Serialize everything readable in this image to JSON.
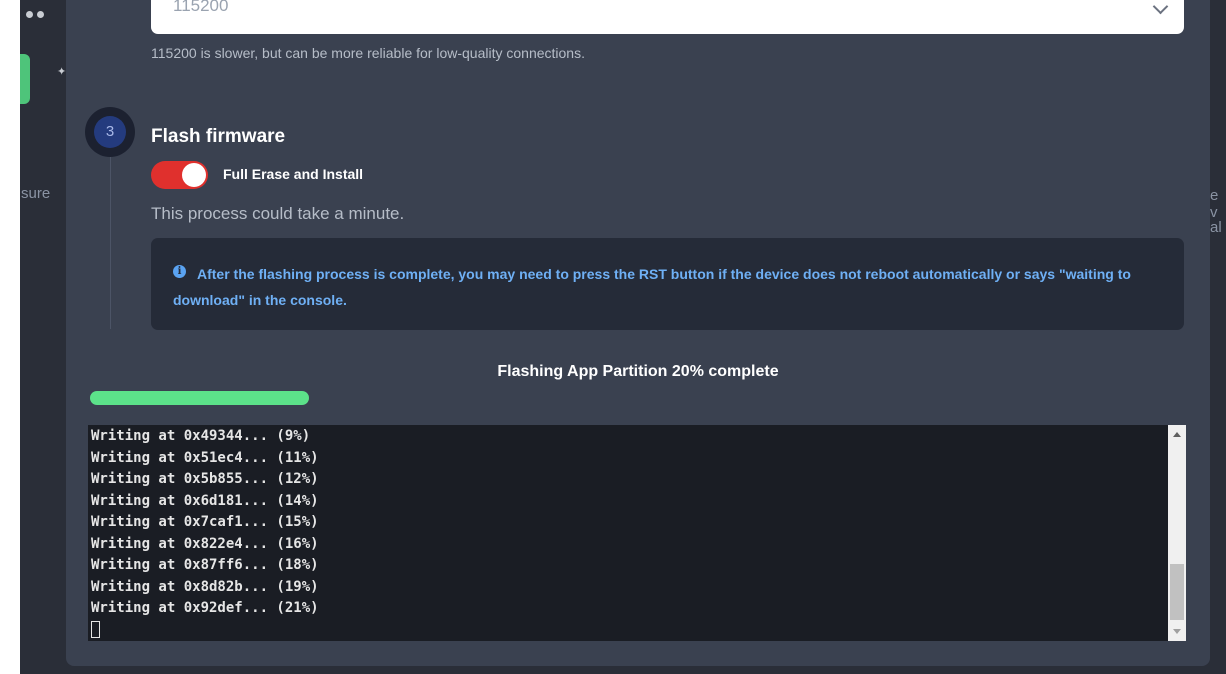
{
  "background": {
    "left_text": "sure",
    "right_text_a": "e v",
    "right_text_b": "al"
  },
  "baud_select": {
    "value": "115200",
    "hint": "115200 is slower, but can be more reliable for low-quality connections."
  },
  "step": {
    "number": "3",
    "title": "Flash firmware"
  },
  "erase_toggle": {
    "label": "Full Erase and Install",
    "enabled": true
  },
  "process_note": "This process could take a minute.",
  "info_box": {
    "icon": "info-icon",
    "text": "After the flashing process is complete, you may need to press the RST button if the device does not reboot automatically or says \"waiting to download\" in the console."
  },
  "progress": {
    "title": "Flashing App Partition 20% complete",
    "percent": 20
  },
  "console": {
    "lines": [
      "Writing at 0x49344... (9%)",
      "Writing at 0x51ec4... (11%)",
      "Writing at 0x5b855... (12%)",
      "Writing at 0x6d181... (14%)",
      "Writing at 0x7caf1... (15%)",
      "Writing at 0x822e4... (16%)",
      "Writing at 0x87ff6... (18%)",
      "Writing at 0x8d82b... (19%)",
      "Writing at 0x92def... (21%)"
    ]
  },
  "colors": {
    "accent_green": "#5ce28a",
    "toggle_red": "#e0302d",
    "info_blue": "#6fb0f5"
  }
}
